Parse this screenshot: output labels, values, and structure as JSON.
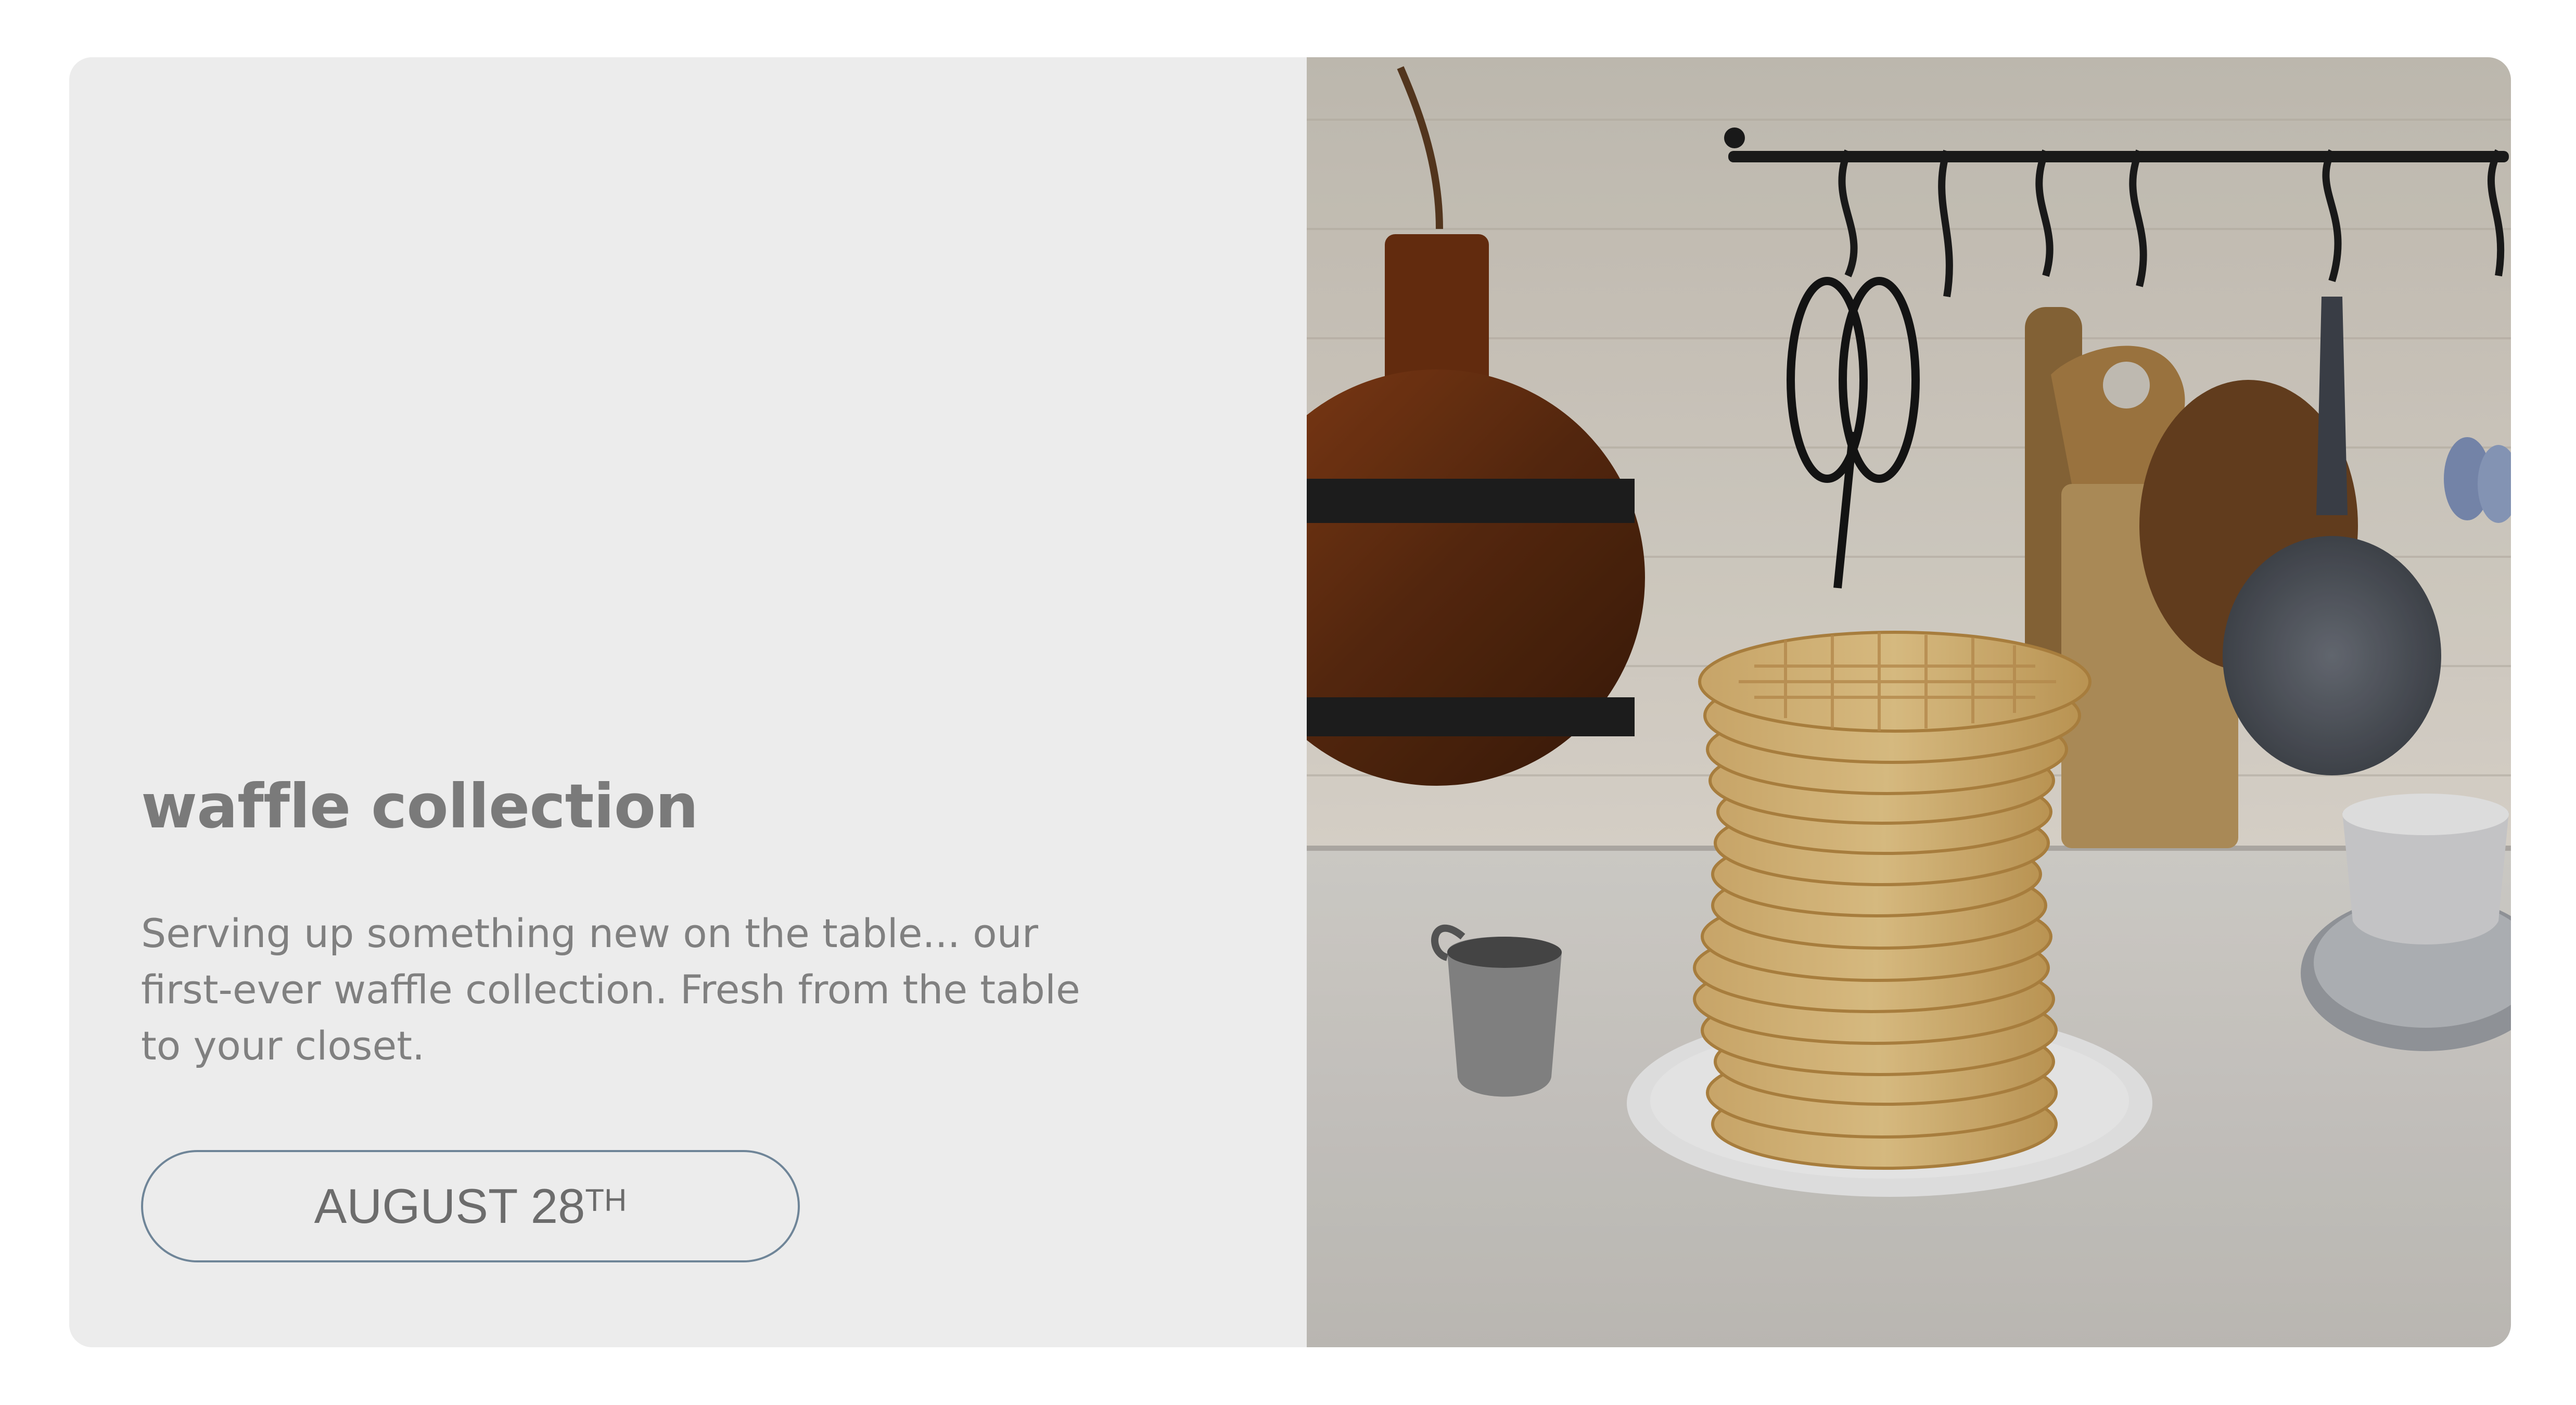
{
  "hero": {
    "title": "waffle collection",
    "description": "Serving up something new on the table... our first-ever waffle collection. Fresh from the table to your closet.",
    "date_button": {
      "label_main": "AUGUST 28",
      "label_suffix": "TH"
    },
    "image": {
      "subject": "stack of waffles on a white plate in a kitchen with hanging cutting boards and pans"
    }
  },
  "colors": {
    "panel_background": "#ececec",
    "title_text": "#7a7a7a",
    "body_text": "#808080",
    "button_border": "#6f8598"
  }
}
